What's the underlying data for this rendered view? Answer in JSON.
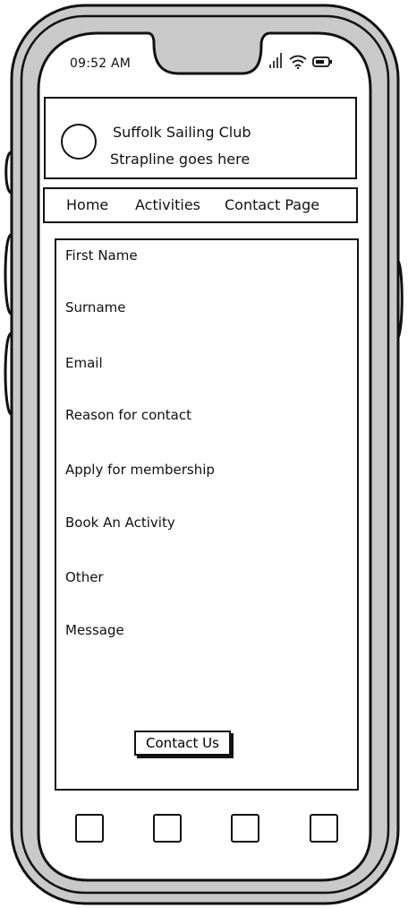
{
  "status_bar": {
    "time": "09:52 AM",
    "signal_icon": "signal-bars-icon",
    "wifi_icon": "wifi-icon",
    "battery_icon": "battery-icon"
  },
  "header": {
    "logo_icon": "logo-circle",
    "title": "Suffolk Sailing Club",
    "strapline": "Strapline goes here"
  },
  "nav": {
    "items": [
      {
        "label": "Home"
      },
      {
        "label": "Activities"
      },
      {
        "label": "Contact Page"
      }
    ]
  },
  "form": {
    "fields": [
      {
        "label": "First Name"
      },
      {
        "label": "Surname"
      },
      {
        "label": "Email"
      },
      {
        "label": "Reason for contact"
      },
      {
        "label": "Apply for membership"
      },
      {
        "label": "Book An Activity"
      },
      {
        "label": "Other"
      },
      {
        "label": "Message"
      }
    ],
    "submit_label": "Contact Us"
  },
  "bottom_bar": {
    "buttons": [
      "square-button",
      "square-button",
      "square-button",
      "square-button"
    ]
  },
  "colors": {
    "frame_fill": "#c9c9c9",
    "stroke": "#111111",
    "screen": "#ffffff"
  }
}
